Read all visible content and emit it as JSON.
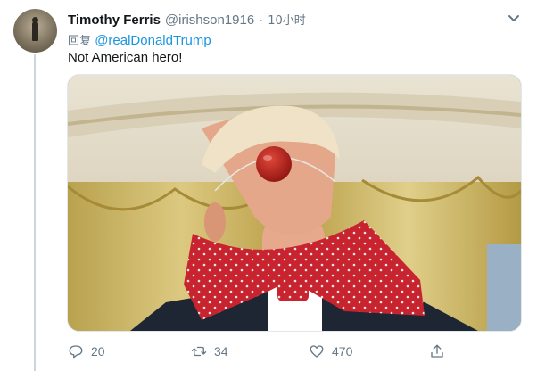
{
  "author": {
    "display_name": "Timothy Ferris",
    "handle": "@irishson1916",
    "separator": "·",
    "time": "10小时"
  },
  "reply": {
    "prefix": "回复",
    "mention": "@realDonaldTrump"
  },
  "tweet": {
    "text": "Not American hero!"
  },
  "actions": {
    "reply_count": "20",
    "retweet_count": "34",
    "like_count": "470"
  },
  "colors": {
    "link": "#1b95e0",
    "muted": "#657786",
    "text": "#14171a"
  },
  "icons": {
    "menu": "chevron-down-icon",
    "reply": "reply-icon",
    "retweet": "retweet-icon",
    "like": "heart-icon",
    "share": "share-icon"
  }
}
